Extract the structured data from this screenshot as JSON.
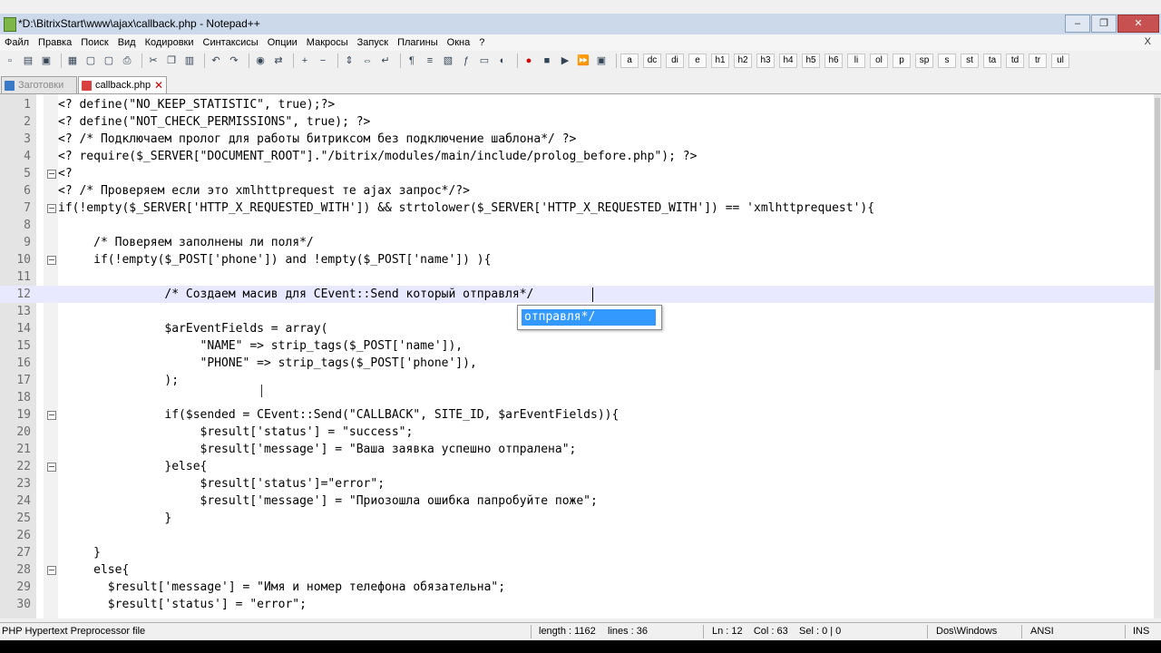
{
  "window": {
    "title": "*D:\\BitrixStart\\www\\ajax\\callback.php - Notepad++",
    "buttons": {
      "minimize": "‒",
      "maximize": "❐",
      "close": "✕"
    }
  },
  "menu": [
    "Файл",
    "Правка",
    "Поиск",
    "Вид",
    "Кодировки",
    "Синтаксисы",
    "Опции",
    "Макросы",
    "Запуск",
    "Плагины",
    "Окна",
    "?"
  ],
  "menu_close": "X",
  "toolbar": {
    "icons": [
      "new-file-icon",
      "open-file-icon",
      "save-icon",
      "save-all-icon",
      "close-icon",
      "close-all-icon",
      "print-icon",
      "cut-icon",
      "copy-icon",
      "paste-icon",
      "undo-icon",
      "redo-icon",
      "find-icon",
      "replace-icon",
      "zoom-in-icon",
      "zoom-out-icon",
      "sync-v-icon",
      "sync-h-icon",
      "wrap-icon",
      "show-all-icon",
      "indent-guide-icon",
      "doc-map-icon",
      "function-list-icon",
      "folder-icon",
      "monitor-icon",
      "record-icon",
      "stop-icon",
      "play-icon",
      "play-multi-icon",
      "save-macro-icon"
    ],
    "tags": [
      "a",
      "dc",
      "di",
      "e",
      "h1",
      "h2",
      "h3",
      "h4",
      "h5",
      "h6",
      "li",
      "ol",
      "p",
      "sp",
      "s",
      "st",
      "ta",
      "td",
      "tr",
      "ul"
    ]
  },
  "tabs": [
    {
      "label": "Заготовки",
      "active": false,
      "icon_color": "#3a78c8"
    },
    {
      "label": "callback.php",
      "active": true,
      "icon_color": "#d84040",
      "close": "✕"
    }
  ],
  "editor": {
    "current_line": 12,
    "lines": [
      {
        "n": "1",
        "text": "<? define(\"NO_KEEP_STATISTIC\", true);?>"
      },
      {
        "n": "2",
        "text": "<? define(\"NOT_CHECK_PERMISSIONS\", true); ?>"
      },
      {
        "n": "3",
        "text": "<? /* Подключаем пролог для работы битриксом без подключение шаблона*/ ?>"
      },
      {
        "n": "4",
        "text": "<? require($_SERVER[\"DOCUMENT_ROOT\"].\"/bitrix/modules/main/include/prolog_before.php\"); ?>"
      },
      {
        "n": "5",
        "text": "<?",
        "fold": true
      },
      {
        "n": "6",
        "text": "<? /* Проверяем если это xmlhttprequest те ajax запрос*/?>"
      },
      {
        "n": "7",
        "text": "if(!empty($_SERVER['HTTP_X_REQUESTED_WITH']) && strtolower($_SERVER['HTTP_X_REQUESTED_WITH']) == 'xmlhttprequest'){",
        "fold": true
      },
      {
        "n": "8",
        "text": ""
      },
      {
        "n": "9",
        "text": "     /* Поверяем заполнены ли поля*/"
      },
      {
        "n": "10",
        "text": "     if(!empty($_POST['phone']) and !empty($_POST['name']) ){",
        "fold": true
      },
      {
        "n": "11",
        "text": ""
      },
      {
        "n": "12",
        "text": "               /* Создаем масив для CEvent::Send который отправля*/"
      },
      {
        "n": "13",
        "text": ""
      },
      {
        "n": "14",
        "text": "               $arEventFields = array("
      },
      {
        "n": "15",
        "text": "                    \"NAME\" => strip_tags($_POST['name']),"
      },
      {
        "n": "16",
        "text": "                    \"PHONE\" => strip_tags($_POST['phone']),"
      },
      {
        "n": "17",
        "text": "               );"
      },
      {
        "n": "18",
        "text": ""
      },
      {
        "n": "19",
        "text": "               if($sended = CEvent::Send(\"CALLBACK\", SITE_ID, $arEventFields)){",
        "fold": true
      },
      {
        "n": "20",
        "text": "                    $result['status'] = \"success\";"
      },
      {
        "n": "21",
        "text": "                    $result['message'] = \"Ваша заявка успешно отпралена\";"
      },
      {
        "n": "22",
        "text": "               }else{",
        "fold": true
      },
      {
        "n": "23",
        "text": "                    $result['status']=\"error\";"
      },
      {
        "n": "24",
        "text": "                    $result['message'] = \"Приозошла ошибка папробуйте поже\";"
      },
      {
        "n": "25",
        "text": "               }"
      },
      {
        "n": "26",
        "text": ""
      },
      {
        "n": "27",
        "text": "     }"
      },
      {
        "n": "28",
        "text": "     else{",
        "fold": true
      },
      {
        "n": "29",
        "text": "       $result['message'] = \"Имя и номер телефона обязательна\";"
      },
      {
        "n": "30",
        "text": "       $result['status'] = \"error\";"
      }
    ],
    "autocomplete": "отправля*/"
  },
  "statusbar": {
    "filetype": "PHP Hypertext Preprocessor file",
    "length": "length : 1162",
    "lines": "lines : 36",
    "position": "Ln : 12    Col : 63    Sel : 0 | 0",
    "eol": "Dos\\Windows",
    "encoding": "ANSI",
    "mode": "INS"
  }
}
